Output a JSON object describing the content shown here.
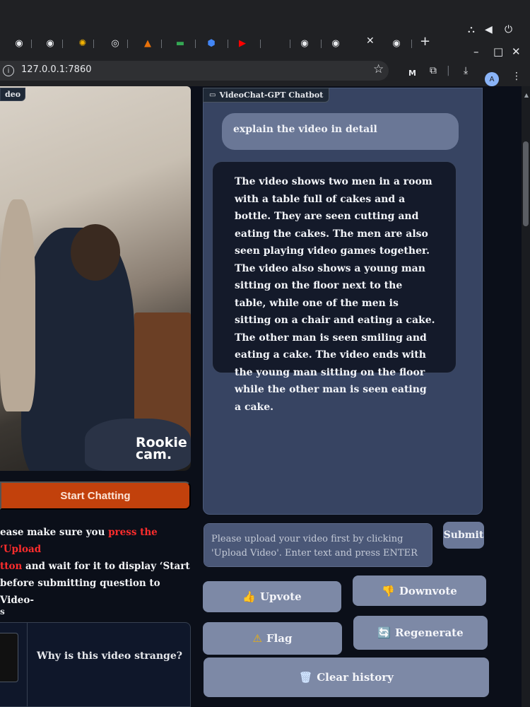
{
  "browser": {
    "url": "127.0.0.1:7860",
    "tab_close": "✕",
    "new_tab": "+",
    "avatar_letter": "A",
    "ext_m": "M"
  },
  "video_panel": {
    "label": "deo",
    "watermark_line1": "Rookie",
    "watermark_line2": "cam.",
    "start_button": "Start Chatting",
    "instructions_pre": "ease make sure you ",
    "instructions_red1": "press the ‘Upload",
    "instructions_red2": "tton",
    "instructions_post1": " and wait for it to display ‘Start",
    "instructions_post2": "before submitting question to Video-",
    "examples_label": "s",
    "example_question": "Why is this video strange?"
  },
  "chat": {
    "label": "VideoChat-GPT Chatbot",
    "user_message": "explain the video in detail",
    "bot_message": "The video shows two men in a room with a table full of cakes and a bottle. They are seen cutting and eating the cakes. The men are also seen playing video games together. The video also shows a young man sitting on the floor next to the table, while one of the men is sitting on a chair and eating a cake. The other man is seen smiling and eating a cake. The video ends with the young man sitting on the floor while the other man is seen eating a cake.",
    "input_placeholder": "Please upload your video first by clicking 'Upload Video'. Enter text and press ENTER",
    "submit_label": "Submit"
  },
  "actions": {
    "upvote": "Upvote",
    "downvote": "Downvote",
    "flag": "Flag",
    "regenerate": "Regenerate",
    "clear": "Clear history"
  },
  "colors": {
    "start_button": "#c2410c",
    "chat_panel": "#374462",
    "action_button": "#7d89a6",
    "warning_text": "#ff2d2d"
  }
}
